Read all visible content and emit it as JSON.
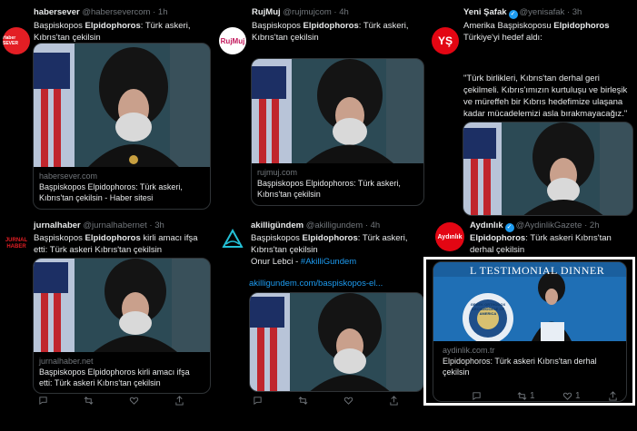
{
  "tweets": [
    {
      "name": "habersever",
      "handle": "@habersevercom",
      "time": "1h",
      "avatar_text": "Haber SEVER",
      "avatar_color": "#e31e24",
      "text_pre": "Başpiskopos ",
      "text_bold": "Elpidophoros",
      "text_post": ": Türk askeri, Kıbrıs'tan çekilsin",
      "card_domain": "habersever.com",
      "card_title": "Başpiskopos Elpidophoros: Türk askeri, Kıbrıs'tan çekilsin - Haber sitesi"
    },
    {
      "name": "RujMuj",
      "handle": "@rujmujcom",
      "time": "4h",
      "avatar_text": "RujMuj",
      "avatar_color": "#ffffff",
      "text_pre": "Başpiskopos ",
      "text_bold": "Elpidophoros",
      "text_post": ": Türk askeri, Kıbrıs'tan çekilsin",
      "card_domain": "rujmuj.com",
      "card_title": "Başpiskopos Elpidophoros: Türk askeri, Kıbrıs'tan çekilsin"
    },
    {
      "name": "Yeni Şafak",
      "handle": "@yenisafak",
      "time": "3h",
      "avatar_text": "YŞ",
      "avatar_color": "#e30613",
      "text_line1_pre": "Amerika Başpiskoposu ",
      "text_line1_bold": "Elpidophoros",
      "text_line2": "Türkiye'yi hedef aldı:",
      "quote": "\"Türk birlikleri, Kıbrıs'tan derhal geri çekilmeli. Kıbrıs'ımızın kurtuluşu ve birleşik ve müreffeh bir Kıbrıs hedefimize ulaşana kadar mücadelemizi asla bırakmayacağız.\""
    },
    {
      "name": "jurnalhaber",
      "handle": "@jurnalhabernet",
      "time": "3h",
      "avatar_text": "JURNAL HABER",
      "avatar_color": "#000000",
      "text_pre": "Başpiskopos ",
      "text_bold": "Elpidophoros",
      "text_post": " kirli amacı ifşa etti: Türk askeri Kıbrıs'tan çekilsin",
      "card_domain": "jurnalhaber.net",
      "card_title": "Başpiskopos Elpidophoros kirli amacı ifşa etti: Türk askeri Kıbrıs'tan çekilsin"
    },
    {
      "name": "akilligündem",
      "handle": "@akilligundem",
      "time": "4h",
      "avatar_color": "#000000",
      "text_pre": "Başpiskopos ",
      "text_bold": "Elpidophoros",
      "text_post": ": Türk askeri, Kıbrıs'tan çekilsin",
      "text_line3_pre": "Onur Lebci - ",
      "hashtag": "#AkilliGundem",
      "link": "akilligundem.com/baspiskopos-el..."
    },
    {
      "name": "Aydınlık",
      "handle": "@AydinlikGazete",
      "time": "2h",
      "avatar_text": "Aydınlık",
      "avatar_color": "#e30613",
      "text_bold": "Elpidophoros",
      "text_post": ": Türk askeri Kıbrıs'tan derhal çekilsin",
      "banner": "L TESTIMONIAL DINNER",
      "seal_text": "GREEK ORTHODOX ARCHDIOCESE OF AMERICA",
      "card_domain": "aydinlik.com.tr",
      "card_title": "Elpidophoros: Türk askeri Kıbrıs'tan derhal çekilsin",
      "retweets": "1",
      "likes": "1"
    }
  ],
  "colors": {
    "accent": "#1d9bf0",
    "muted": "#71767b",
    "text": "#e7e9ea"
  }
}
